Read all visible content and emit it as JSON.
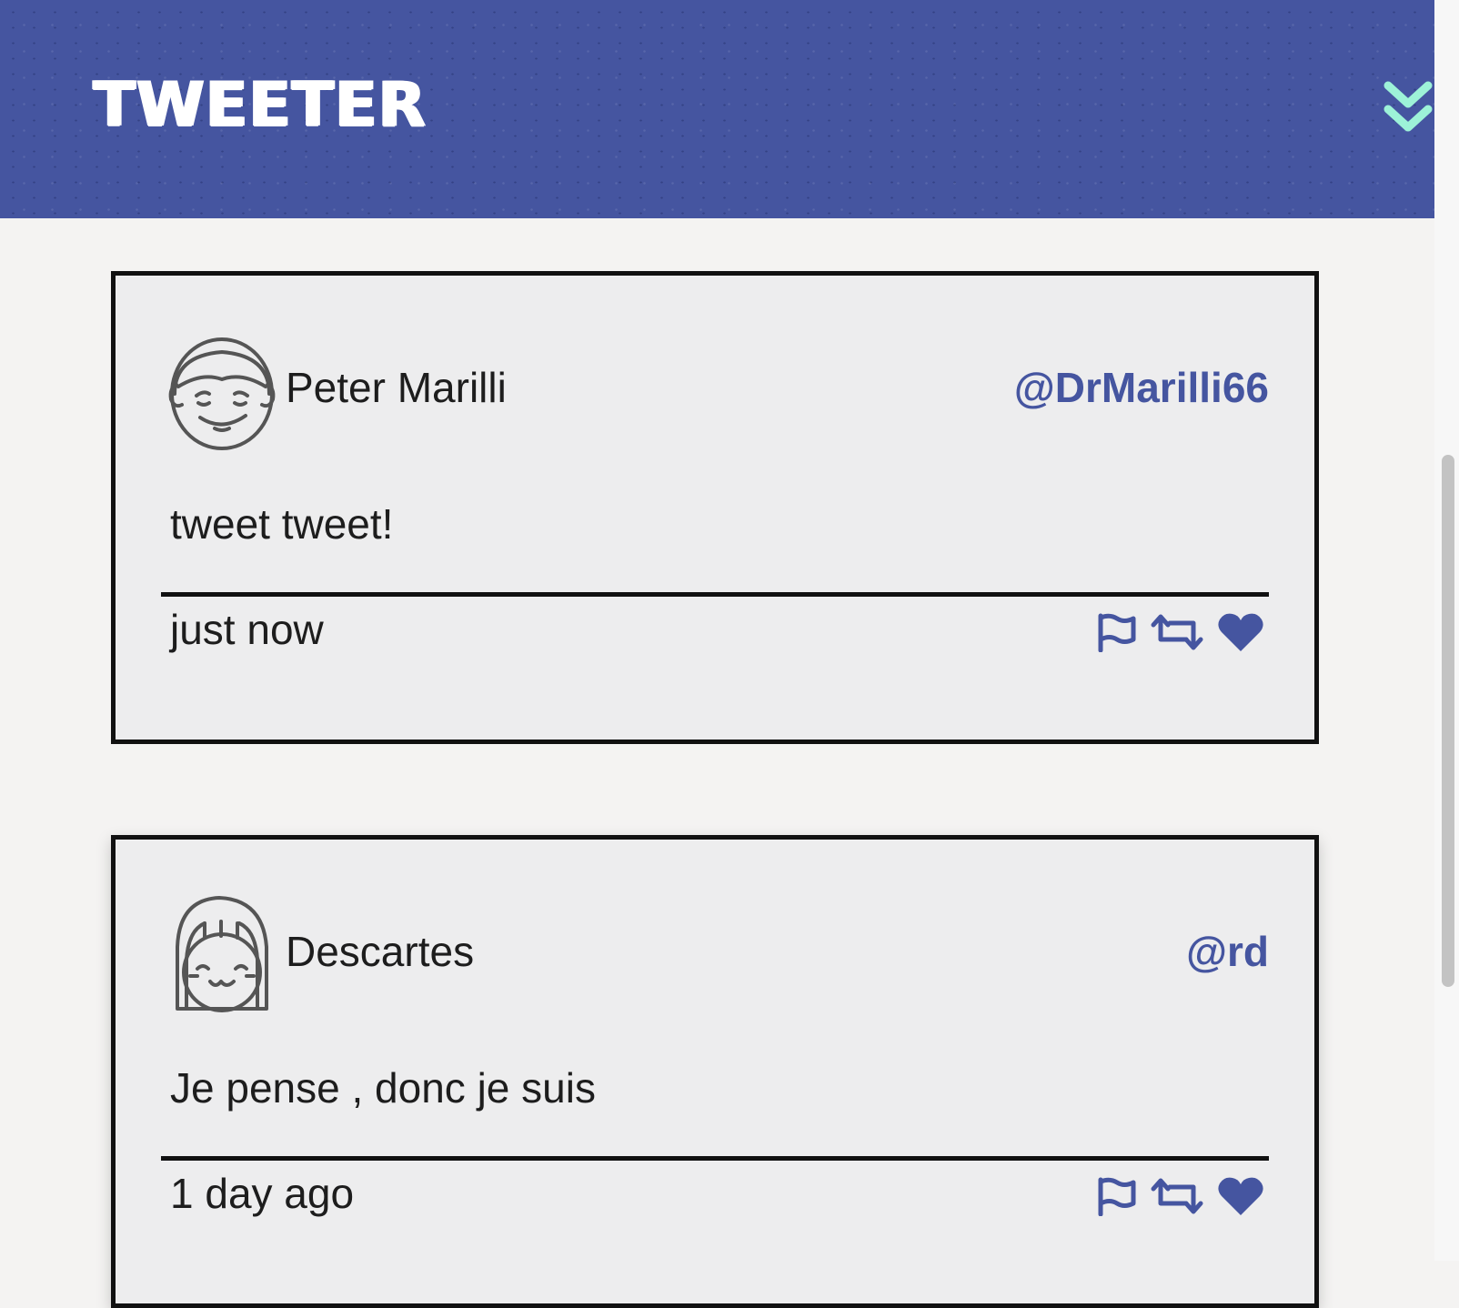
{
  "app": {
    "brand": "TWEETER",
    "toggle_icon": "double-chevron-down-icon",
    "colors": {
      "header": "#4555a0",
      "accent": "#4555a0",
      "toggle": "#9df2d8",
      "card_border": "#111111",
      "card_bg": "#ededee"
    }
  },
  "tweets": [
    {
      "name": "Peter Marilli",
      "handle": "@DrMarilli66",
      "avatar": "smiling-man-avatar",
      "content": "tweet tweet!",
      "time": "just now",
      "actions": [
        "flag-icon",
        "retweet-icon",
        "heart-icon"
      ]
    },
    {
      "name": "Descartes",
      "handle": "@rd",
      "avatar": "smiling-girl-avatar",
      "content": "Je pense , donc je suis",
      "time": "1 day ago",
      "actions": [
        "flag-icon",
        "retweet-icon",
        "heart-icon"
      ]
    }
  ]
}
